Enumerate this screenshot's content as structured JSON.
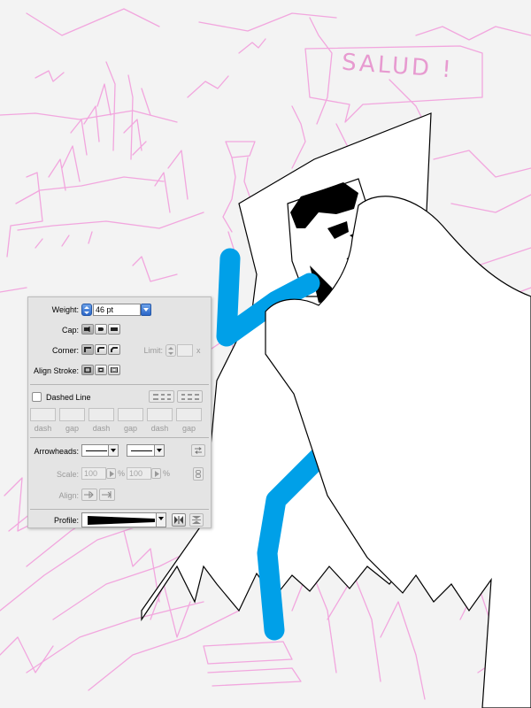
{
  "canvas": {
    "speech_text": "SALUD !",
    "sketch_color": "#f2a6de",
    "fill_color": "#ffffff",
    "stroke_color": "#00a0e8",
    "outline_color": "#000000"
  },
  "stroke_panel": {
    "weight": {
      "label": "Weight:",
      "value": "46 pt"
    },
    "cap": {
      "label": "Cap:",
      "options": [
        "butt-cap-icon",
        "round-cap-icon",
        "projecting-cap-icon"
      ],
      "selected": 0
    },
    "corner": {
      "label": "Corner:",
      "options": [
        "miter-join-icon",
        "round-join-icon",
        "bevel-join-icon"
      ],
      "selected": 0
    },
    "limit": {
      "label": "Limit:",
      "value": "",
      "multiplier": "x"
    },
    "align_stroke": {
      "label": "Align Stroke:",
      "options": [
        "align-center-icon",
        "align-inside-icon",
        "align-outside-icon"
      ],
      "selected": 0
    },
    "dashed_line": {
      "label": "Dashed Line",
      "checked": false
    },
    "dash_fields": [
      "dash",
      "gap",
      "dash",
      "gap",
      "dash",
      "gap"
    ],
    "arrowheads": {
      "label": "Arrowheads:"
    },
    "scale": {
      "label": "Scale:",
      "start": "100",
      "end": "100",
      "unit": "%"
    },
    "align": {
      "label": "Align:"
    },
    "profile": {
      "label": "Profile:"
    }
  }
}
